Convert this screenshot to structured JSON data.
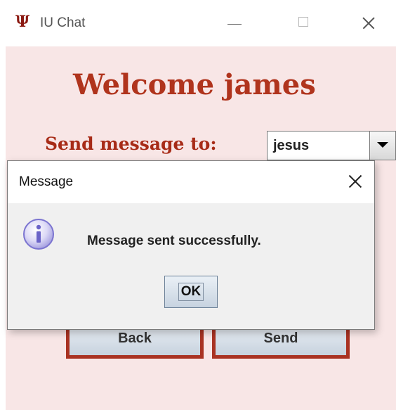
{
  "window": {
    "icon": "Ψ",
    "title": "IU Chat",
    "controls": [
      "minimize-icon",
      "maximize-icon",
      "close-icon"
    ]
  },
  "main": {
    "welcome": "Welcome james",
    "send_to_label": "Send message to:",
    "recipient": "jesus",
    "back_label": "Back",
    "send_label": "Send"
  },
  "dialog": {
    "title": "Message",
    "message": "Message sent successfully.",
    "ok_label": "OK",
    "icon": "info-icon"
  },
  "colors": {
    "background": "#f8e6e6",
    "heading": "#b0341d",
    "button_border": "#a93222",
    "info_icon": "#7b74d0"
  }
}
